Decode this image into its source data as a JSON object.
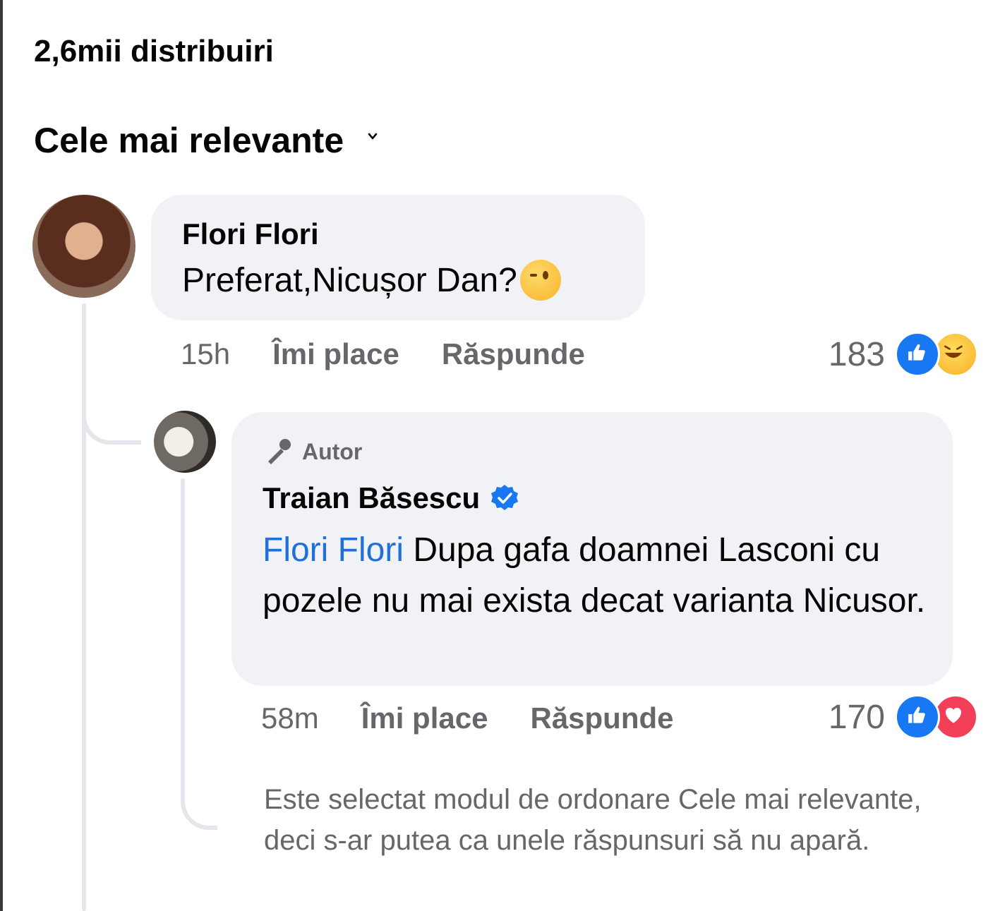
{
  "shares": {
    "label": "2,6mii distribuiri"
  },
  "sort": {
    "label": "Cele mai relevante"
  },
  "comment": {
    "author": "Flori Flori",
    "text": "Preferat,Nicușor Dan?",
    "emoji": "wink-emoji",
    "time": "15h",
    "like_label": "Îmi place",
    "reply_label": "Răspunde",
    "reaction_count": "183",
    "reaction_icons": [
      "like-icon",
      "haha-icon"
    ]
  },
  "reply": {
    "badge": "Autor",
    "author": "Traian Băsescu",
    "verified": true,
    "mention": "Flori Flori",
    "text": " Dupa gafa doamnei Lasconi cu pozele nu mai exista decat varianta Nicusor.",
    "time": "58m",
    "like_label": "Îmi place",
    "reply_label": "Răspunde",
    "reaction_count": "170",
    "reaction_icons": [
      "like-icon",
      "love-icon"
    ]
  },
  "notice": "Este selectat modul de ordonare Cele mai relevante, deci s-ar putea ca unele răspunsuri să nu apară.",
  "colors": {
    "mention": "#216fdb",
    "like": "#1877f2",
    "love": "#f33e58",
    "bubble": "#f0f2f5",
    "meta": "#65676b"
  }
}
